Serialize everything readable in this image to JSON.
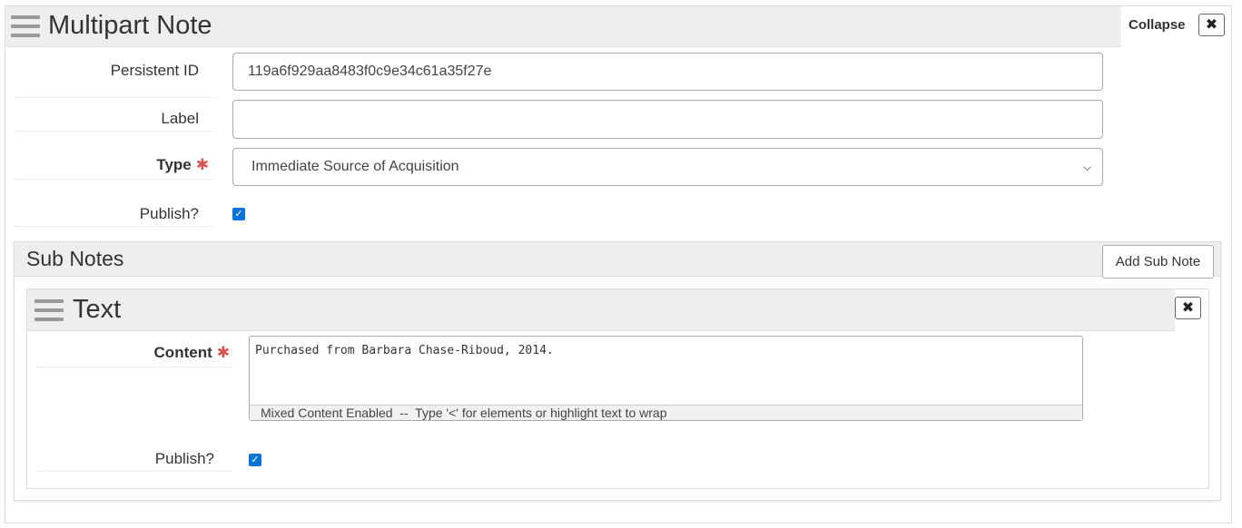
{
  "multipart_note": {
    "title": "Multipart Note",
    "collapse_label": "Collapse",
    "remove_glyph": "✖",
    "fields": {
      "persistent_id_label": "Persistent ID",
      "persistent_id_value": "119a6f929aa8483f0c9e34c61a35f27e",
      "label_label": "Label",
      "label_value": "",
      "type_label": "Type",
      "type_value": "Immediate Source of Acquisition",
      "publish_label": "Publish?",
      "publish_checked": true
    },
    "required_marker": "✱"
  },
  "sub_notes": {
    "title": "Sub Notes",
    "add_button_label": "Add Sub Note",
    "text_note": {
      "title": "Text",
      "remove_glyph": "✖",
      "content_label": "Content",
      "content_value": "Purchased from Barbara Chase-Riboud, 2014.",
      "content_hint": "Mixed Content Enabled  --  Type '<' for elements or highlight text to wrap",
      "publish_label": "Publish?",
      "publish_checked": true
    }
  },
  "icons": {
    "drag_handle": "drag-handle-icon",
    "remove": "close-icon",
    "select_chevron": "chevron-down-icon",
    "checkbox": "checkmark-icon"
  },
  "colors": {
    "header_bg": "#eeeeee",
    "required": "#d9534f",
    "checkbox": "#0b73d8"
  }
}
